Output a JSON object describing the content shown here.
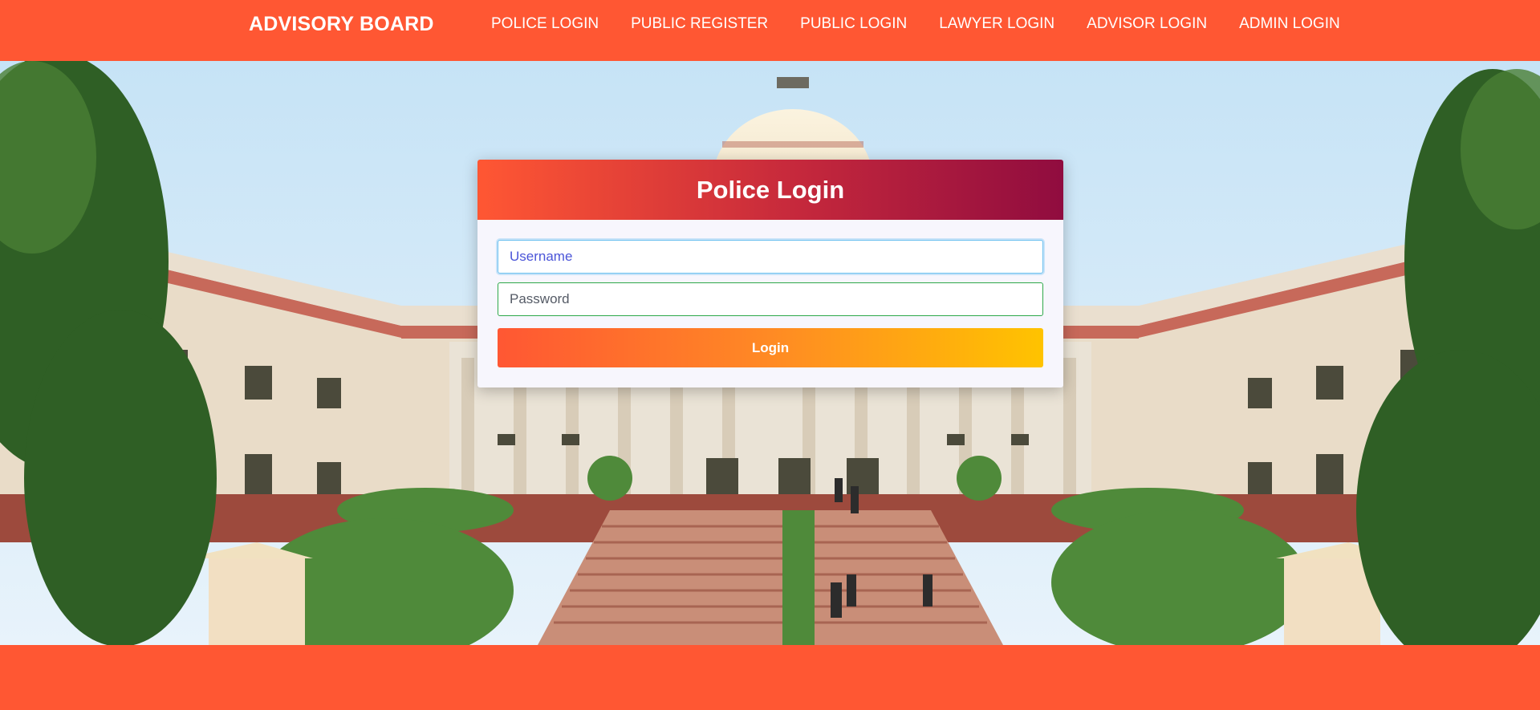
{
  "navbar": {
    "brand": "ADVISORY BOARD",
    "links": [
      {
        "label": "POLICE LOGIN"
      },
      {
        "label": "PUBLIC REGISTER"
      },
      {
        "label": "PUBLIC LOGIN"
      },
      {
        "label": "LAWYER LOGIN"
      },
      {
        "label": "ADVISOR LOGIN"
      },
      {
        "label": "ADMIN LOGIN"
      }
    ]
  },
  "login": {
    "title": "Police Login",
    "username_placeholder": "Username",
    "password_placeholder": "Password",
    "button_label": "Login"
  },
  "colors": {
    "brand_orange": "#ff5733",
    "header_gradient_end": "#900c3f",
    "button_gradient_end": "#ffc300"
  }
}
